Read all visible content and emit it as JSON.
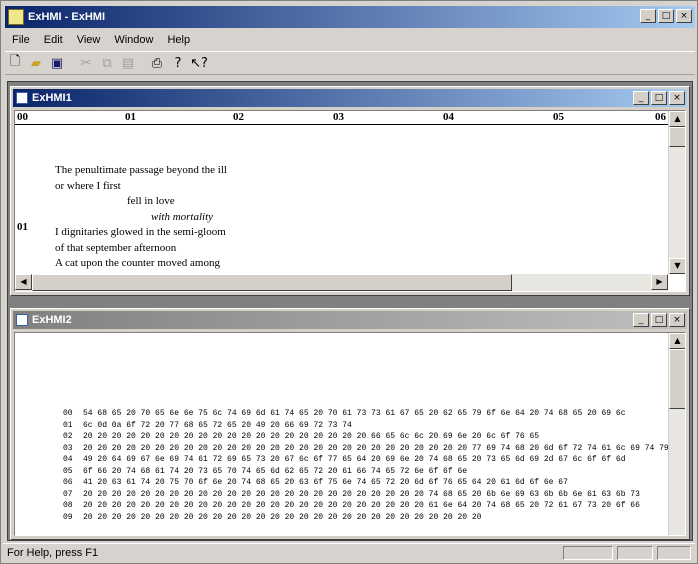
{
  "app": {
    "title": "ExHMI - ExHMI"
  },
  "menu": [
    "File",
    "Edit",
    "View",
    "Window",
    "Help"
  ],
  "toolbar": {
    "icons": [
      "new-file-icon",
      "open-folder-icon",
      "save-icon",
      "cut-icon",
      "copy-icon",
      "paste-icon",
      "print-icon",
      "help-icon",
      "context-help-icon"
    ]
  },
  "child1": {
    "title": "ExHMI1",
    "ruler": [
      "00",
      "01",
      "02",
      "03",
      "04",
      "05",
      "06"
    ],
    "side_label": "01",
    "poem": [
      "The penultimate passage beyond the ill",
      "or where I first",
      "fell in love",
      "with mortality",
      "I dignitaries glowed in the semi-gloom",
      "of that september afternoon",
      "A cat upon the counter moved among"
    ]
  },
  "child2": {
    "title": "ExHMI2",
    "hex_rows": [
      {
        "off": "00",
        "bytes": "54 68 65 20 70 65 6e 6e 75 6c 74 69 6d 61 74 65 20 70 61 73 73 61 67 65 20 62 65 79 6f 6e 64 20 74 68 65 20 69 6c"
      },
      {
        "off": "01",
        "bytes": "6c 0d 0a 6f 72 20 77 68 65 72 65 20 49 20 66 69 72 73 74"
      },
      {
        "off": "02",
        "bytes": "20 20 20 20 20 20 20 20 20 20 20 20 20 20 20 20 20 20 20 20 66 65 6c 6c 20 69 6e 20 6c 6f 76 65"
      },
      {
        "off": "03",
        "bytes": "20 20 20 20 20 20 20 20 20 20 20 20 20 20 20 20 20 20 20 20 20 20 20 20 20 20 20 77 69 74 68 20 6d 6f 72 74 61 6c 69 74 79"
      },
      {
        "off": "04",
        "bytes": "49 20 64 69 67 6e 69 74 61 72 69 65 73 20 67 6c 6f 77 65 64 20 69 6e 20 74 68 65 20 73 65 6d 69 2d 67 6c 6f 6f 6d"
      },
      {
        "off": "05",
        "bytes": "6f 66 20 74 68 61 74 20 73 65 70 74 65 6d 62 65 72 20 61 66 74 65 72 6e 6f 6f 6e"
      },
      {
        "off": "06",
        "bytes": "41 20 63 61 74 20 75 70 6f 6e 20 74 68 65 20 63 6f 75 6e 74 65 72 20 6d 6f 76 65 64 20 61 6d 6f 6e 67"
      },
      {
        "off": "07",
        "bytes": "20 20 20 20 20 20 20 20 20 20 20 20 20 20 20 20 20 20 20 20 20 20 20 20 74 68 65 20 6b 6e 69 63 6b 6b 6e 61 63 6b 73"
      },
      {
        "off": "08",
        "bytes": "20 20 20 20 20 20 20 20 20 20 20 20 20 20 20 20 20 20 20 20 20 20 20 20 61 6e 64 20 74 68 65 20 72 61 67 73 20 6f 66"
      },
      {
        "off": "09",
        "bytes": "20 20 20 20 20 20 20 20 20 20 20 20 20 20 20 20 20 20 20 20 20 20 20 20 20 20 20 20"
      }
    ]
  },
  "status": {
    "text": "For Help, press F1"
  }
}
